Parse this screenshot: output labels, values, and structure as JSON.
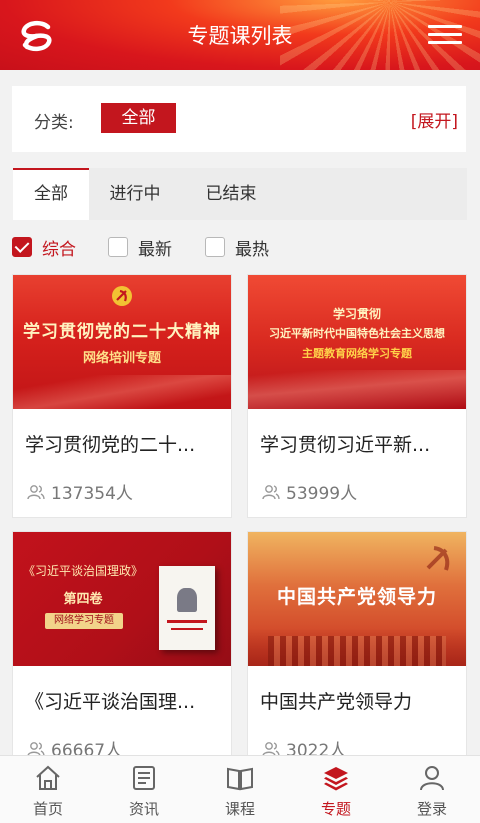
{
  "header": {
    "title": "专题课列表"
  },
  "category": {
    "label": "分类:",
    "selected": "全部",
    "expand": "[展开]"
  },
  "tabs": [
    {
      "label": "全部",
      "active": true
    },
    {
      "label": "进行中",
      "active": false
    },
    {
      "label": "已结束",
      "active": false
    }
  ],
  "sort": [
    {
      "label": "综合",
      "checked": true
    },
    {
      "label": "最新",
      "checked": false
    },
    {
      "label": "最热",
      "checked": false
    }
  ],
  "cards": [
    {
      "title": "学习贯彻党的二十...",
      "count": "137354人",
      "banner": {
        "line1": "学习贯彻党的二十大精神",
        "line2": "网络培训专题"
      }
    },
    {
      "title": "学习贯彻习近平新...",
      "count": "53999人",
      "banner": {
        "line1": "学习贯彻",
        "line2": "习近平新时代中国特色社会主义思想",
        "line3": "主题教育网络学习专题"
      }
    },
    {
      "title": "《习近平谈治国理...",
      "count": "66667人",
      "banner": {
        "line1": "《习近平谈治国理政》",
        "line2": "第四卷",
        "line3": "网络学习专题"
      }
    },
    {
      "title": "中国共产党领导力",
      "count": "3022人",
      "banner": {
        "line1": "中国共产党领导力"
      }
    }
  ],
  "bottom_nav": [
    {
      "label": "首页",
      "icon": "home-icon",
      "active": false
    },
    {
      "label": "资讯",
      "icon": "news-icon",
      "active": false
    },
    {
      "label": "课程",
      "icon": "book-icon",
      "active": false
    },
    {
      "label": "专题",
      "icon": "layers-icon",
      "active": true
    },
    {
      "label": "登录",
      "icon": "user-icon",
      "active": false
    }
  ],
  "colors": {
    "brand": "#c3161e",
    "header": "#d8161c"
  }
}
